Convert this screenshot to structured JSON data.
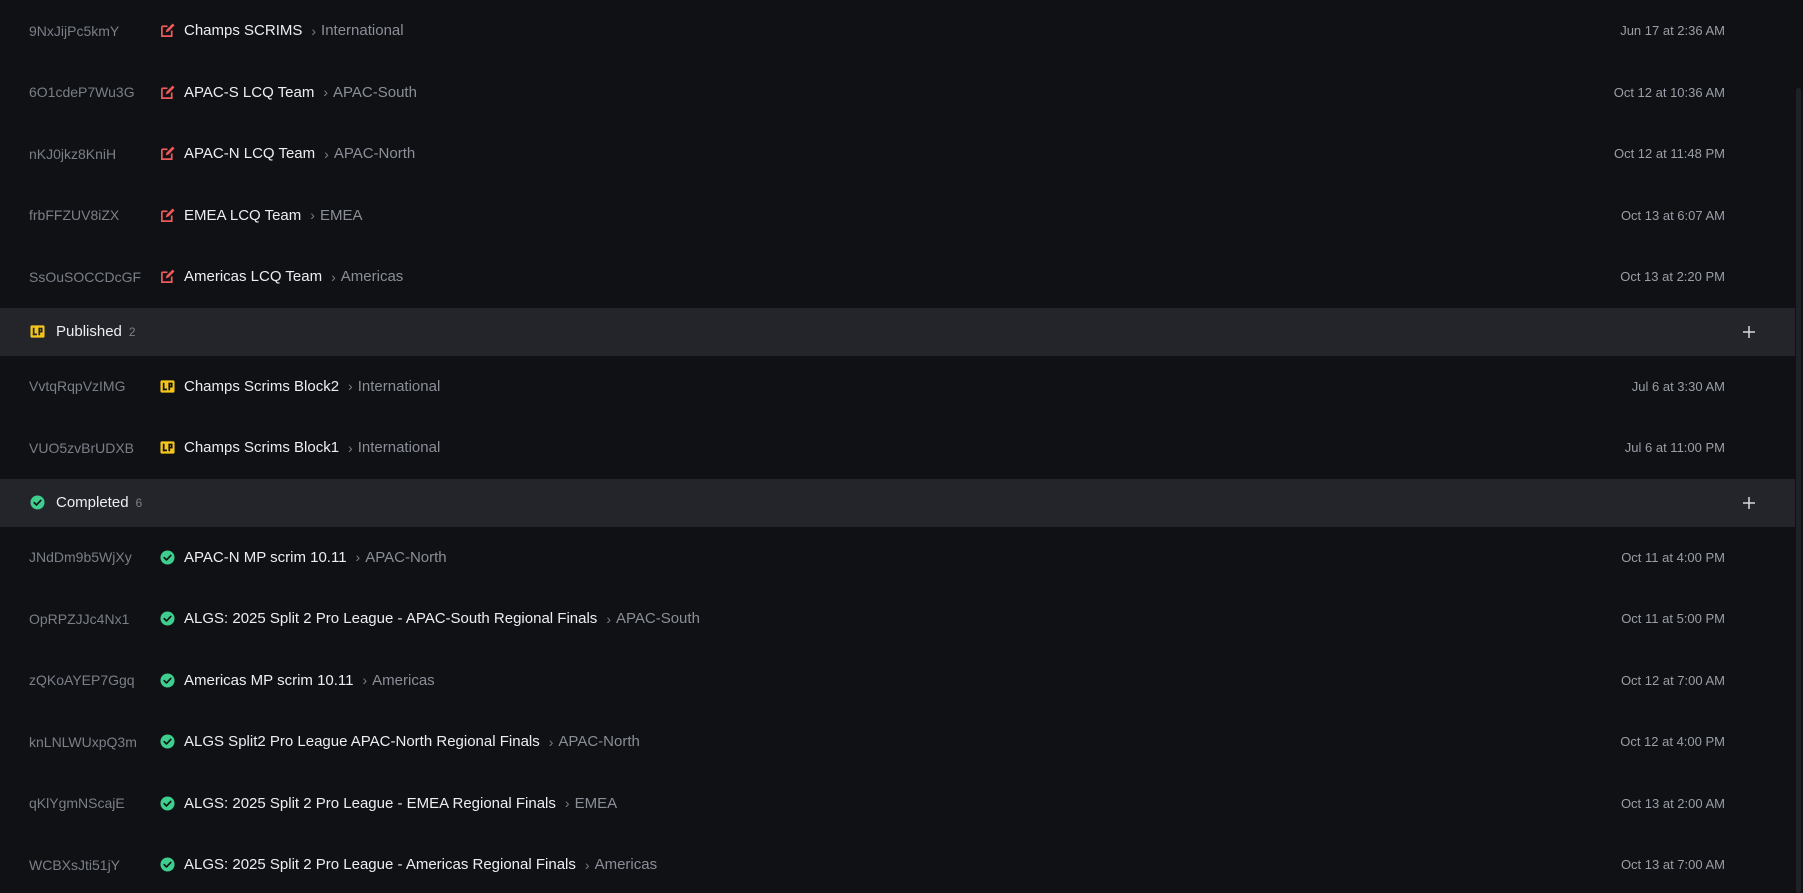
{
  "colors": {
    "background": "#0f1115",
    "group_header_bg": "#23252a",
    "draft_icon": "#f05a5a",
    "published_icon": "#f5c51a",
    "completed_icon": "#3ecf8e"
  },
  "rows_top": [
    {
      "id": "9NxJijPc5kmY",
      "icon": "edit-icon",
      "name": "Champs SCRIMS",
      "region": "International",
      "date": "Jun 17 at 2:36 AM"
    },
    {
      "id": "6O1cdeP7Wu3G",
      "icon": "edit-icon",
      "name": "APAC-S LCQ Team",
      "region": "APAC-South",
      "date": "Oct 12 at 10:36 AM"
    },
    {
      "id": "nKJ0jkz8KniH",
      "icon": "edit-icon",
      "name": "APAC-N LCQ Team",
      "region": "APAC-North",
      "date": "Oct 12 at 11:48 PM"
    },
    {
      "id": "frbFFZUV8iZX",
      "icon": "edit-icon",
      "name": "EMEA LCQ Team",
      "region": "EMEA",
      "date": "Oct 13 at 6:07 AM"
    },
    {
      "id": "SsOuSOCCDcGF",
      "icon": "edit-icon",
      "name": "Americas LCQ Team",
      "region": "Americas",
      "date": "Oct 13 at 2:20 PM"
    }
  ],
  "published": {
    "label": "Published",
    "count": "2",
    "add_icon": "plus-icon",
    "rows": [
      {
        "id": "VvtqRqpVzIMG",
        "icon": "published-icon",
        "name": "Champs Scrims Block2",
        "region": "International",
        "date": "Jul 6 at 3:30 AM"
      },
      {
        "id": "VUO5zvBrUDXB",
        "icon": "published-icon",
        "name": "Champs Scrims Block1",
        "region": "International",
        "date": "Jul 6 at 11:00 PM"
      }
    ]
  },
  "completed": {
    "label": "Completed",
    "count": "6",
    "add_icon": "plus-icon",
    "rows": [
      {
        "id": "JNdDm9b5WjXy",
        "icon": "check-circle-icon",
        "name": "APAC-N MP scrim 10.11",
        "region": "APAC-North",
        "date": "Oct 11 at 4:00 PM"
      },
      {
        "id": "OpRPZJJc4Nx1",
        "icon": "check-circle-icon",
        "name": "ALGS: 2025 Split 2 Pro League - APAC-South Regional Finals",
        "region": "APAC-South",
        "date": "Oct 11 at 5:00 PM"
      },
      {
        "id": "zQKoAYEP7Ggq",
        "icon": "check-circle-icon",
        "name": "Americas MP scrim 10.11",
        "region": "Americas",
        "date": "Oct 12 at 7:00 AM"
      },
      {
        "id": "knLNLWUxpQ3m",
        "icon": "check-circle-icon",
        "name": "ALGS Split2 Pro League APAC-North Regional Finals",
        "region": "APAC-North",
        "date": "Oct 12 at 4:00 PM"
      },
      {
        "id": "qKlYgmNScajE",
        "icon": "check-circle-icon",
        "name": "ALGS: 2025 Split 2 Pro League - EMEA Regional Finals",
        "region": "EMEA",
        "date": "Oct 13 at 2:00 AM"
      },
      {
        "id": "WCBXsJti51jY",
        "icon": "check-circle-icon",
        "name": "ALGS: 2025 Split 2 Pro League - Americas Regional Finals",
        "region": "Americas",
        "date": "Oct 13 at 7:00 AM"
      }
    ]
  }
}
